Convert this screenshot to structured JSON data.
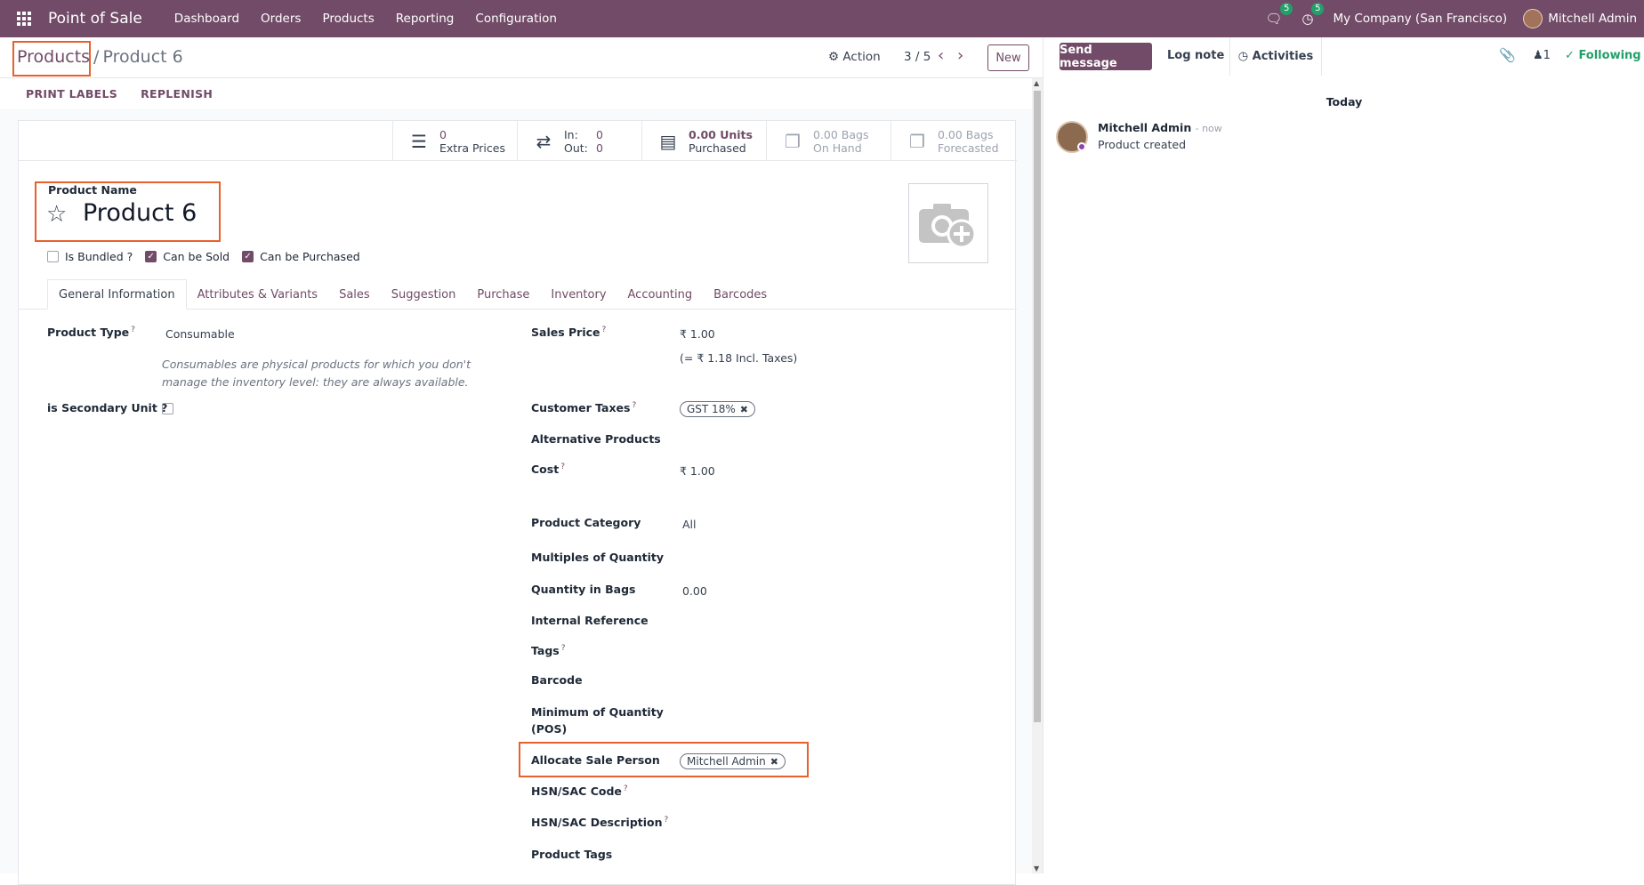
{
  "navbar": {
    "brand": "Point of Sale",
    "menu": [
      "Dashboard",
      "Orders",
      "Products",
      "Reporting",
      "Configuration"
    ],
    "messages_badge": "5",
    "activities_badge": "5",
    "company": "My Company (San Francisco)",
    "user": "Mitchell Admin"
  },
  "control": {
    "breadcrumb_parent": "Products",
    "breadcrumb_sep": "/",
    "breadcrumb_current": "Product 6",
    "action_label": "Action",
    "pager": "3 / 5",
    "new_label": "New"
  },
  "header_buttons": [
    "PRINT LABELS",
    "REPLENISH"
  ],
  "stats": {
    "extra_prices": {
      "value": "0",
      "label": "Extra Prices"
    },
    "in_out": {
      "in_label": "In:",
      "in_value": "0",
      "out_label": "Out:",
      "out_value": "0"
    },
    "purchased": {
      "value": "0.00 Units",
      "label": "Purchased"
    },
    "on_hand": {
      "value": "0.00 Bags",
      "label": "On Hand"
    },
    "forecasted": {
      "value": "0.00 Bags",
      "label": "Forecasted"
    }
  },
  "product": {
    "name_label": "Product Name",
    "name": "Product 6",
    "checks": [
      {
        "label": "Is Bundled ?",
        "checked": false
      },
      {
        "label": "Can be Sold",
        "checked": true
      },
      {
        "label": "Can be Purchased",
        "checked": true
      }
    ]
  },
  "tabs": [
    "General Information",
    "Attributes & Variants",
    "Sales",
    "Suggestion",
    "Purchase",
    "Inventory",
    "Accounting",
    "Barcodes"
  ],
  "fields": {
    "product_type_label": "Product Type",
    "product_type": "Consumable",
    "product_type_note": "Consumables are physical products for which you don't manage the inventory level: they are always available.",
    "secondary_unit_label": "is Secondary Unit ?",
    "sales_price_label": "Sales Price",
    "sales_price": "₹ 1.00",
    "sales_price_incl": "(= ₹ 1.18 Incl. Taxes)",
    "customer_taxes_label": "Customer Taxes",
    "customer_taxes_tag": "GST 18%",
    "alt_products_label": "Alternative Products",
    "cost_label": "Cost",
    "cost": "₹ 1.00",
    "category_label": "Product Category",
    "category": "All",
    "multiples_label": "Multiples of Quantity",
    "qty_bags_label": "Quantity in Bags",
    "qty_bags": "0.00",
    "internal_ref_label": "Internal Reference",
    "tags_label": "Tags",
    "barcode_label": "Barcode",
    "min_qty_label_1": "Minimum of Quantity",
    "min_qty_label_2": "(POS)",
    "sale_person_label": "Allocate Sale Person",
    "sale_person_tag": "Mitchell Admin",
    "hsn_code_label": "HSN/SAC Code",
    "hsn_desc_label": "HSN/SAC Description",
    "product_tags_label": "Product Tags"
  },
  "chatter": {
    "send_message": "Send message",
    "log_note": "Log note",
    "activities": "Activities",
    "followers_count": "1",
    "following": "Following",
    "date_sep": "Today",
    "author": "Mitchell Admin",
    "time": "- now",
    "body": "Product created"
  }
}
